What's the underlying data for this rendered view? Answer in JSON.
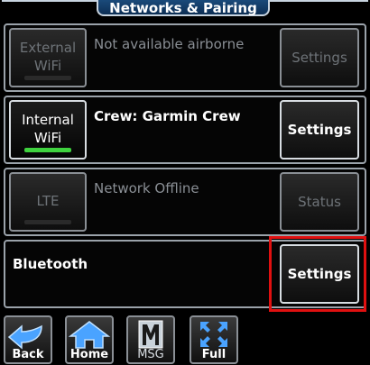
{
  "title": "Networks & Pairing",
  "rows": [
    {
      "button_label": "External WiFi",
      "status": "Not available airborne",
      "side_button": "Settings"
    },
    {
      "button_label": "Internal WiFi",
      "status": "Crew: Garmin Crew",
      "side_button": "Settings"
    },
    {
      "button_label": "LTE",
      "status": "Network Offline",
      "side_button": "Status"
    },
    {
      "status": "Bluetooth",
      "side_button": "Settings"
    }
  ],
  "bottom_bar": {
    "back": "Back",
    "home": "Home",
    "msg": "MSG",
    "full": "Full"
  },
  "colors": {
    "active_indicator": "#3fd23f",
    "highlight": "#e01010",
    "title_bg": "#1a4a7a"
  }
}
